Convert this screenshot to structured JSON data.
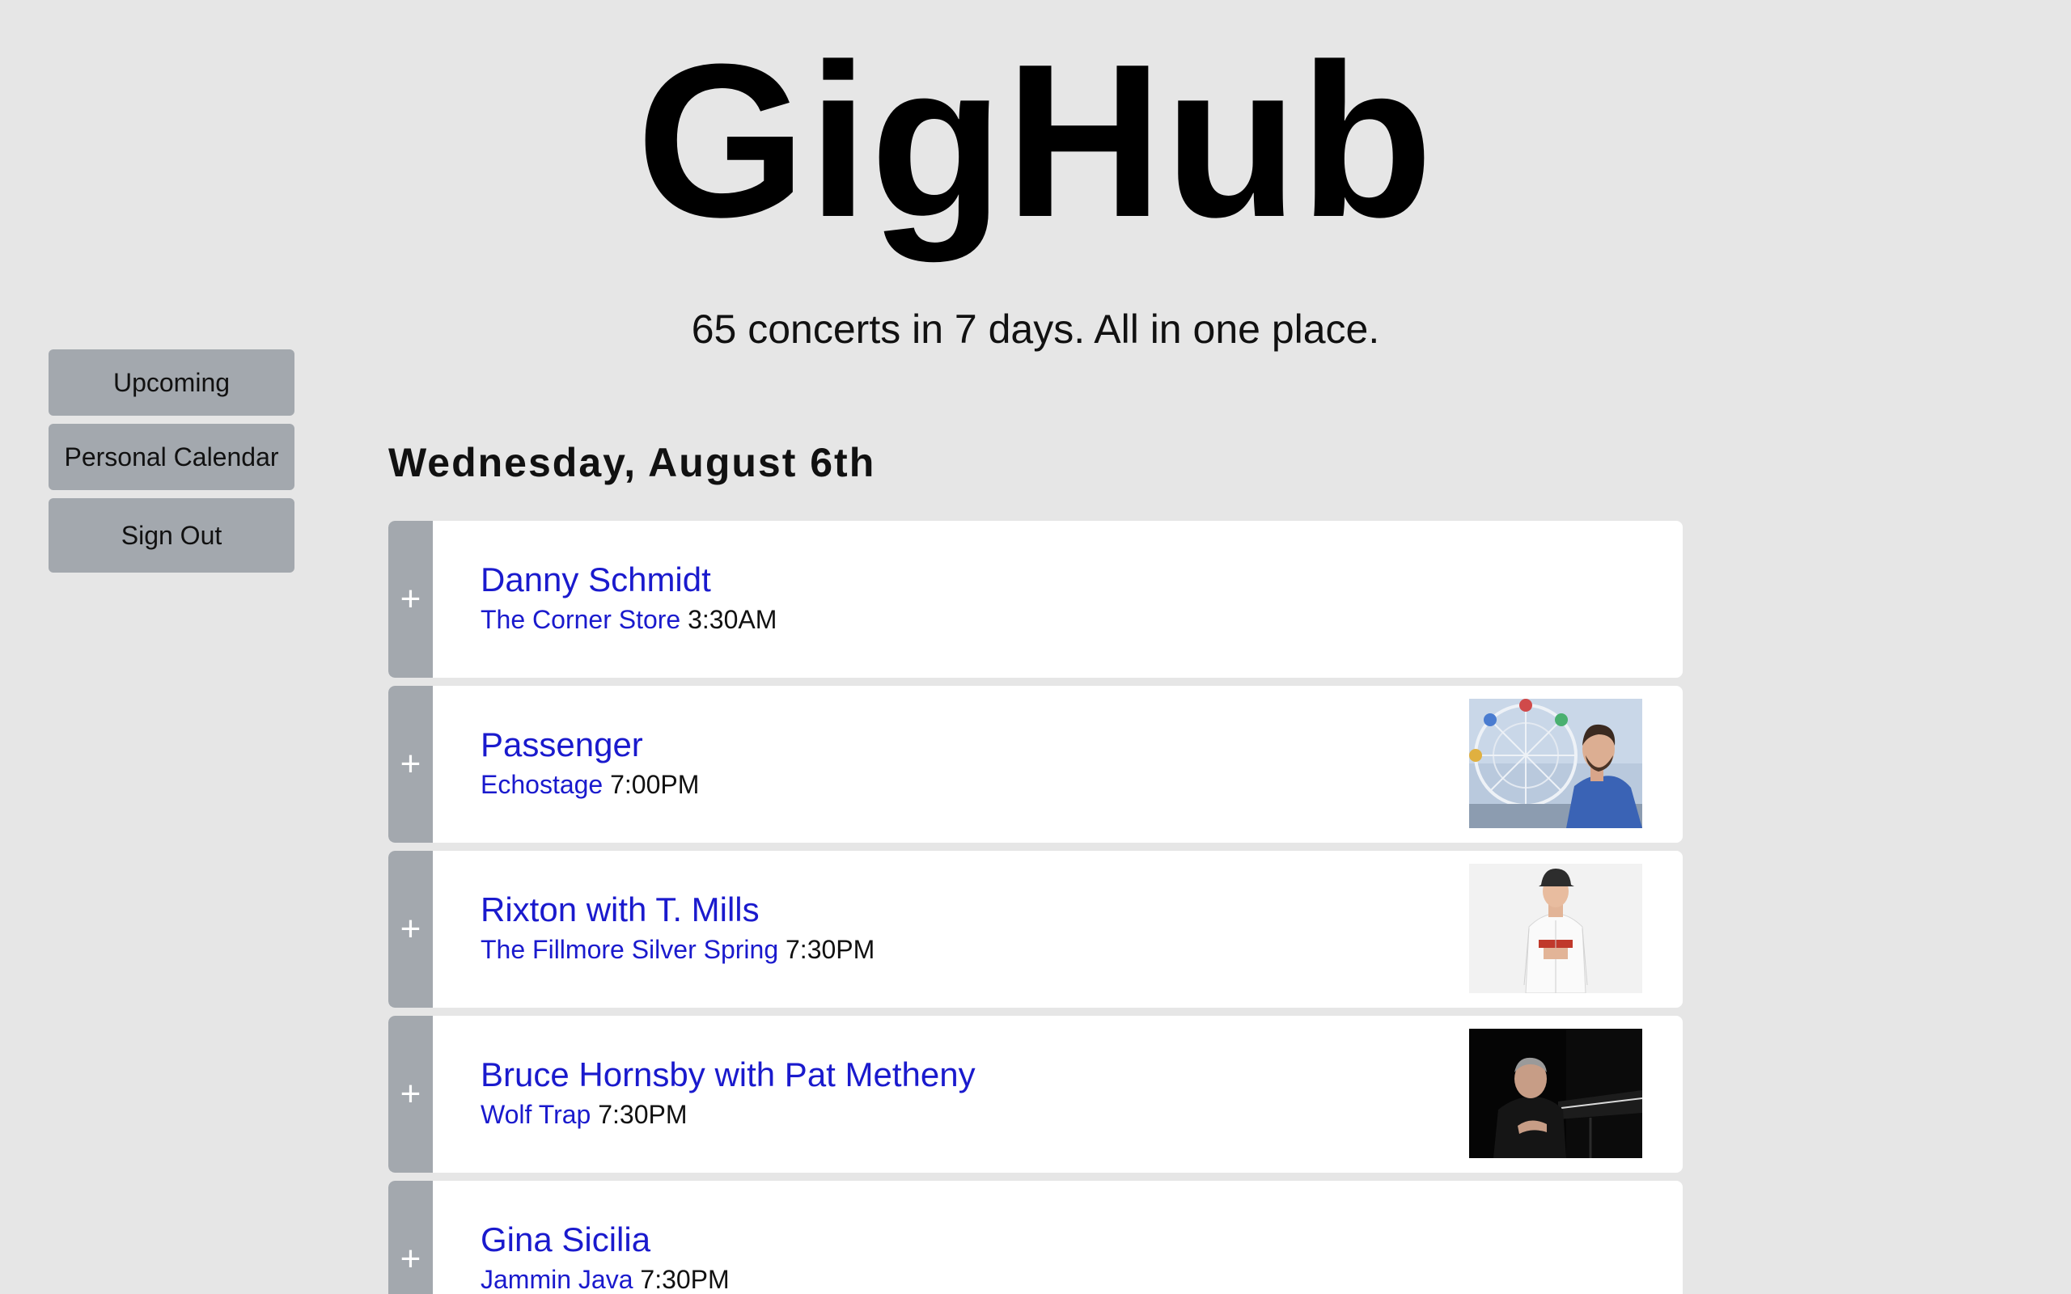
{
  "site": {
    "title": "GigHub",
    "tagline": "65 concerts in 7 days. All in one place."
  },
  "sidebar": {
    "items": [
      {
        "label": "Upcoming"
      },
      {
        "label": "Personal Calendar"
      },
      {
        "label": "Sign Out"
      }
    ]
  },
  "day": {
    "heading": "Wednesday, August 6th"
  },
  "events": [
    {
      "add": "+",
      "artist": "Danny Schmidt",
      "venue": "The Corner Store",
      "time": "3:30AM",
      "photo": null
    },
    {
      "add": "+",
      "artist": "Passenger",
      "venue": "Echostage",
      "time": "7:00PM",
      "photo": "ferris-wheel-man-in-blue-shirt"
    },
    {
      "add": "+",
      "artist": "Rixton with T. Mills",
      "venue": "The Fillmore Silver Spring",
      "time": "7:30PM",
      "photo": "man-in-baseball-jersey"
    },
    {
      "add": "+",
      "artist": "Bruce Hornsby with Pat Metheny",
      "venue": "Wolf Trap",
      "time": "7:30PM",
      "photo": "man-at-piano-dark"
    },
    {
      "add": "+",
      "artist": "Gina Sicilia",
      "venue": "Jammin Java",
      "time": "7:30PM",
      "photo": null
    }
  ],
  "colors": {
    "background": "#e6e6e6",
    "sidebar_button": "#a3a8ae",
    "link": "#1a1acd",
    "card": "#ffffff"
  }
}
